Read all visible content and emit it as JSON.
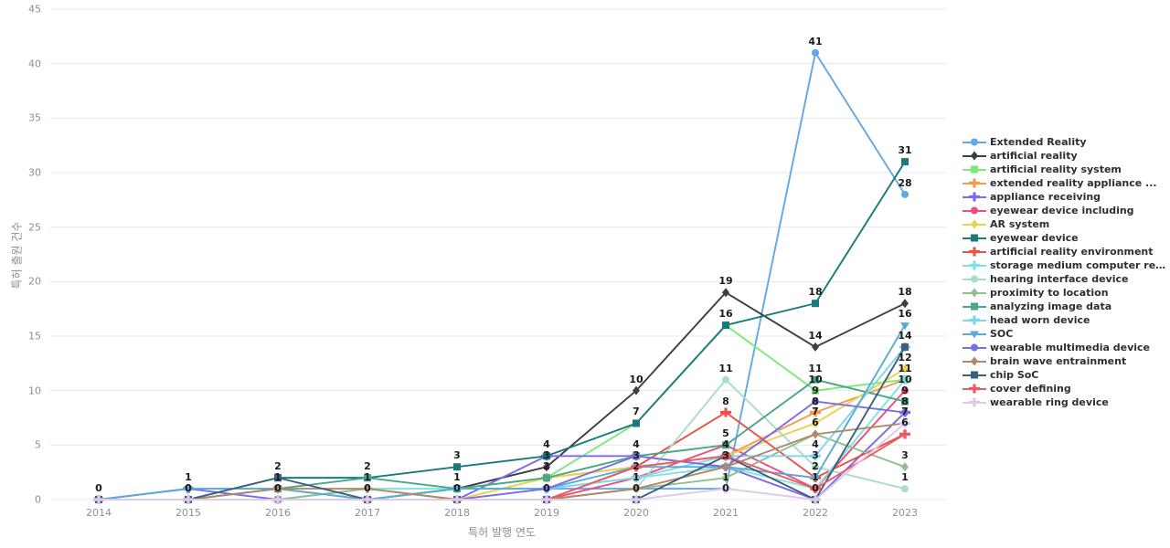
{
  "chart_data": {
    "type": "line",
    "title": "",
    "xlabel": "특허 발행 연도",
    "ylabel": "특허 출원 건수",
    "categories": [
      "2014",
      "2015",
      "2016",
      "2017",
      "2018",
      "2019",
      "2020",
      "2021",
      "2022",
      "2023"
    ],
    "ylim": [
      0,
      45
    ],
    "yticks": [
      0,
      5,
      10,
      15,
      20,
      25,
      30,
      35,
      40,
      45
    ],
    "grid": true,
    "legend_position": "right",
    "show_data_labels": true,
    "series": [
      {
        "name": "Extended Reality",
        "color": "#62a8e5",
        "marker": "circle",
        "values": [
          0,
          1,
          1,
          0,
          1,
          1,
          1,
          1,
          41,
          28
        ]
      },
      {
        "name": "artificial reality",
        "color": "#3a3f44",
        "marker": "diamond",
        "values": [
          0,
          0,
          0,
          0,
          1,
          3,
          10,
          19,
          14,
          18
        ]
      },
      {
        "name": "artificial reality system",
        "color": "#7de87d",
        "marker": "square",
        "values": [
          0,
          0,
          0,
          0,
          1,
          2,
          7,
          16,
          10,
          11
        ]
      },
      {
        "name": "extended reality appliance ...",
        "color": "#f59a4e",
        "marker": "star",
        "values": [
          0,
          0,
          1,
          0,
          0,
          2,
          3,
          4,
          8,
          11
        ]
      },
      {
        "name": "appliance receiving",
        "color": "#7b68ee",
        "marker": "star",
        "values": [
          0,
          1,
          0,
          0,
          0,
          4,
          4,
          3,
          0,
          8
        ]
      },
      {
        "name": "eyewear device including",
        "color": "#ee4d7f",
        "marker": "circle",
        "values": [
          0,
          0,
          0,
          0,
          0,
          0,
          2,
          5,
          1,
          10
        ]
      },
      {
        "name": "AR system",
        "color": "#e8d44d",
        "marker": "diamond",
        "values": [
          0,
          0,
          0,
          0,
          0,
          2,
          3,
          4,
          7,
          12
        ]
      },
      {
        "name": "eyewear device",
        "color": "#1a7a7a",
        "marker": "square",
        "values": [
          0,
          0,
          2,
          2,
          3,
          4,
          7,
          16,
          18,
          31
        ]
      },
      {
        "name": "artificial reality environment",
        "color": "#ec5046",
        "marker": "star",
        "values": [
          0,
          0,
          0,
          0,
          0,
          0,
          3,
          8,
          2,
          6
        ]
      },
      {
        "name": "storage medium computer rea...",
        "color": "#7fe3e0",
        "marker": "star",
        "values": [
          0,
          0,
          0,
          1,
          1,
          1,
          2,
          3,
          1,
          11
        ]
      },
      {
        "name": "hearing interface device",
        "color": "#a8ddc8",
        "marker": "circle",
        "values": [
          0,
          0,
          0,
          0,
          0,
          0,
          1,
          11,
          3,
          1
        ]
      },
      {
        "name": "proximity to location",
        "color": "#8fbf8f",
        "marker": "diamond",
        "values": [
          0,
          0,
          0,
          1,
          0,
          0,
          1,
          2,
          6,
          3
        ]
      },
      {
        "name": "analyzing image data",
        "color": "#49a787",
        "marker": "square",
        "values": [
          0,
          0,
          1,
          2,
          1,
          2,
          4,
          5,
          11,
          9
        ]
      },
      {
        "name": "head worn device",
        "color": "#7fd6ef",
        "marker": "star",
        "values": [
          0,
          0,
          0,
          0,
          0,
          1,
          2,
          4,
          4,
          14
        ]
      },
      {
        "name": "SOC",
        "color": "#5aabd6",
        "marker": "triangle",
        "values": [
          0,
          1,
          1,
          0,
          1,
          1,
          3,
          3,
          2,
          16
        ]
      },
      {
        "name": "wearable multimedia device",
        "color": "#7b6fe0",
        "marker": "circle",
        "values": [
          0,
          0,
          0,
          0,
          0,
          1,
          4,
          3,
          9,
          8
        ]
      },
      {
        "name": "brain wave entrainment",
        "color": "#b08968",
        "marker": "diamond",
        "values": [
          0,
          0,
          1,
          1,
          0,
          0,
          1,
          3,
          6,
          7
        ]
      },
      {
        "name": "chip SoC",
        "color": "#3d6080",
        "marker": "square",
        "values": [
          0,
          0,
          2,
          0,
          0,
          0,
          0,
          4,
          0,
          14
        ]
      },
      {
        "name": "cover defining",
        "color": "#ec5a62",
        "marker": "star",
        "values": [
          0,
          0,
          0,
          0,
          0,
          0,
          3,
          4,
          1,
          6
        ]
      },
      {
        "name": "wearable ring device",
        "color": "#e0c8e8",
        "marker": "star",
        "values": [
          0,
          0,
          0,
          0,
          0,
          0,
          0,
          1,
          0,
          7
        ]
      }
    ],
    "data_labels": {
      "2014": [
        "0"
      ],
      "2015": [
        "1",
        "0"
      ],
      "2016": [
        "2",
        "1",
        "0"
      ],
      "2017": [
        "2",
        "1",
        "0"
      ],
      "2018": [
        "3",
        "1",
        "0"
      ],
      "2019": [
        "4",
        "3",
        "2",
        "0"
      ],
      "2020": [
        "10",
        "7",
        "4",
        "3",
        "2",
        "1",
        "0"
      ],
      "2021": [
        "19",
        "16",
        "11",
        "8",
        "5",
        "4",
        "3",
        "1",
        "0"
      ],
      "2022": [
        "41",
        "18",
        "14",
        "11",
        "10",
        "9",
        "8",
        "7",
        "6",
        "4",
        "3",
        "2",
        "1",
        "0"
      ],
      "2023": [
        "31",
        "28",
        "18",
        "16",
        "14",
        "12",
        "11",
        "10",
        "9",
        "8",
        "7",
        "6",
        "3",
        "1"
      ]
    }
  },
  "colors": {
    "grid": "#e8e8ec",
    "tick_text": "#8a8f98",
    "label_text": "#1a1a1a",
    "legend_text": "#2b2f33",
    "background": "#ffffff"
  }
}
